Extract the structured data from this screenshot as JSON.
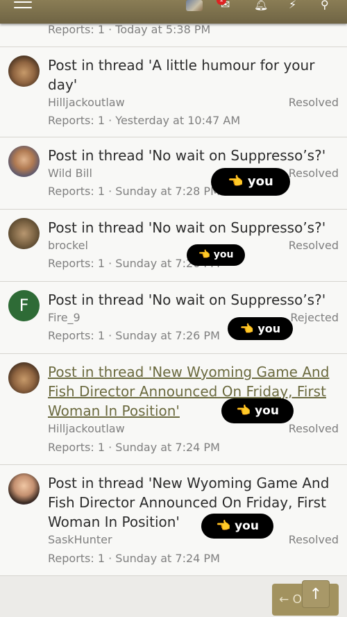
{
  "header": {
    "notification_count": "1"
  },
  "partial_item": {
    "meta": "Reports: 1 · Today at 5:38 PM"
  },
  "items": [
    {
      "title": "Post in thread 'A little humour for your day'",
      "user": "Hilljackoutlaw",
      "status": "Resolved",
      "meta": "Reports: 1 · Yesterday at 10:47 AM"
    },
    {
      "title": "Post in thread 'No wait on Suppresso’s?'",
      "user": "Wild Bill",
      "status": "Resolved",
      "meta": "Reports: 1 · Sunday at 7:28 PM"
    },
    {
      "title": "Post in thread 'No wait on Suppresso’s?'",
      "user": "brockel",
      "status": "Resolved",
      "meta": "Reports: 1 · Sunday at 7:26 PM"
    },
    {
      "title": "Post in thread 'No wait on Suppresso’s?'",
      "user": "Fire_9",
      "avatar_letter": "F",
      "status": "Rejected",
      "meta": "Reports: 1 · Sunday at 7:26 PM"
    },
    {
      "title": "Post in thread 'New Wyoming Game And Fish Director Announced On Friday, First Woman In Position'",
      "user": "Hilljackoutlaw",
      "status": "Resolved",
      "meta": "Reports: 1 · Sunday at 7:24 PM"
    },
    {
      "title": "Post in thread 'New Wyoming Game And Fish Director Announced On Friday, First Woman In Position'",
      "user": "SaskHunter",
      "status": "Resolved",
      "meta": "Reports: 1 · Sunday at 7:24 PM"
    }
  ],
  "stickers": [
    {
      "text": "👈 you"
    },
    {
      "text": "👈 you"
    },
    {
      "text": "👈 you"
    },
    {
      "text": "👈 you"
    },
    {
      "text": "👈 you"
    }
  ],
  "pagination": {
    "older_label": "← Older",
    "scroll_top_glyph": "↑"
  },
  "colors": {
    "header": "#7a6e4c",
    "accent_button": "#a2925f",
    "link_title": "#6b6a3f",
    "fire9_avatar": "#2e6b36"
  }
}
